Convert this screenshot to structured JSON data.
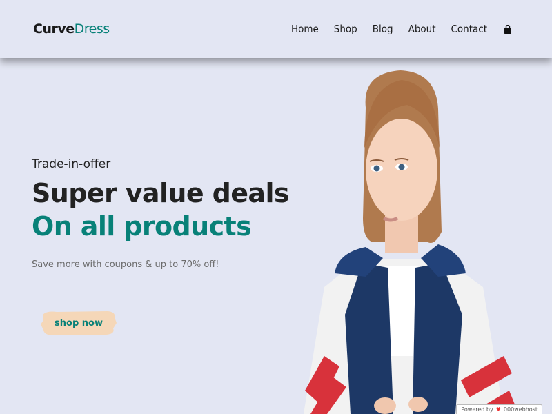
{
  "header": {
    "logo_part1": "Curve",
    "logo_part2": "Dress",
    "nav": [
      "Home",
      "Shop",
      "Blog",
      "About",
      "Contact"
    ]
  },
  "hero": {
    "kicker": "Trade-in-offer",
    "heading": "Super value deals",
    "highlight": "On all products",
    "subtext": "Save more with coupons & up to 70% off!",
    "button_label": "shop now"
  },
  "badge": {
    "powered_by": "Powered by",
    "brand": "000webhost"
  },
  "colors": {
    "background": "#e3e6f3",
    "accent": "#088178",
    "button_bg": "#f5d7b8",
    "dark_text": "#222222"
  },
  "icons": [
    "shopping-bag-icon"
  ]
}
